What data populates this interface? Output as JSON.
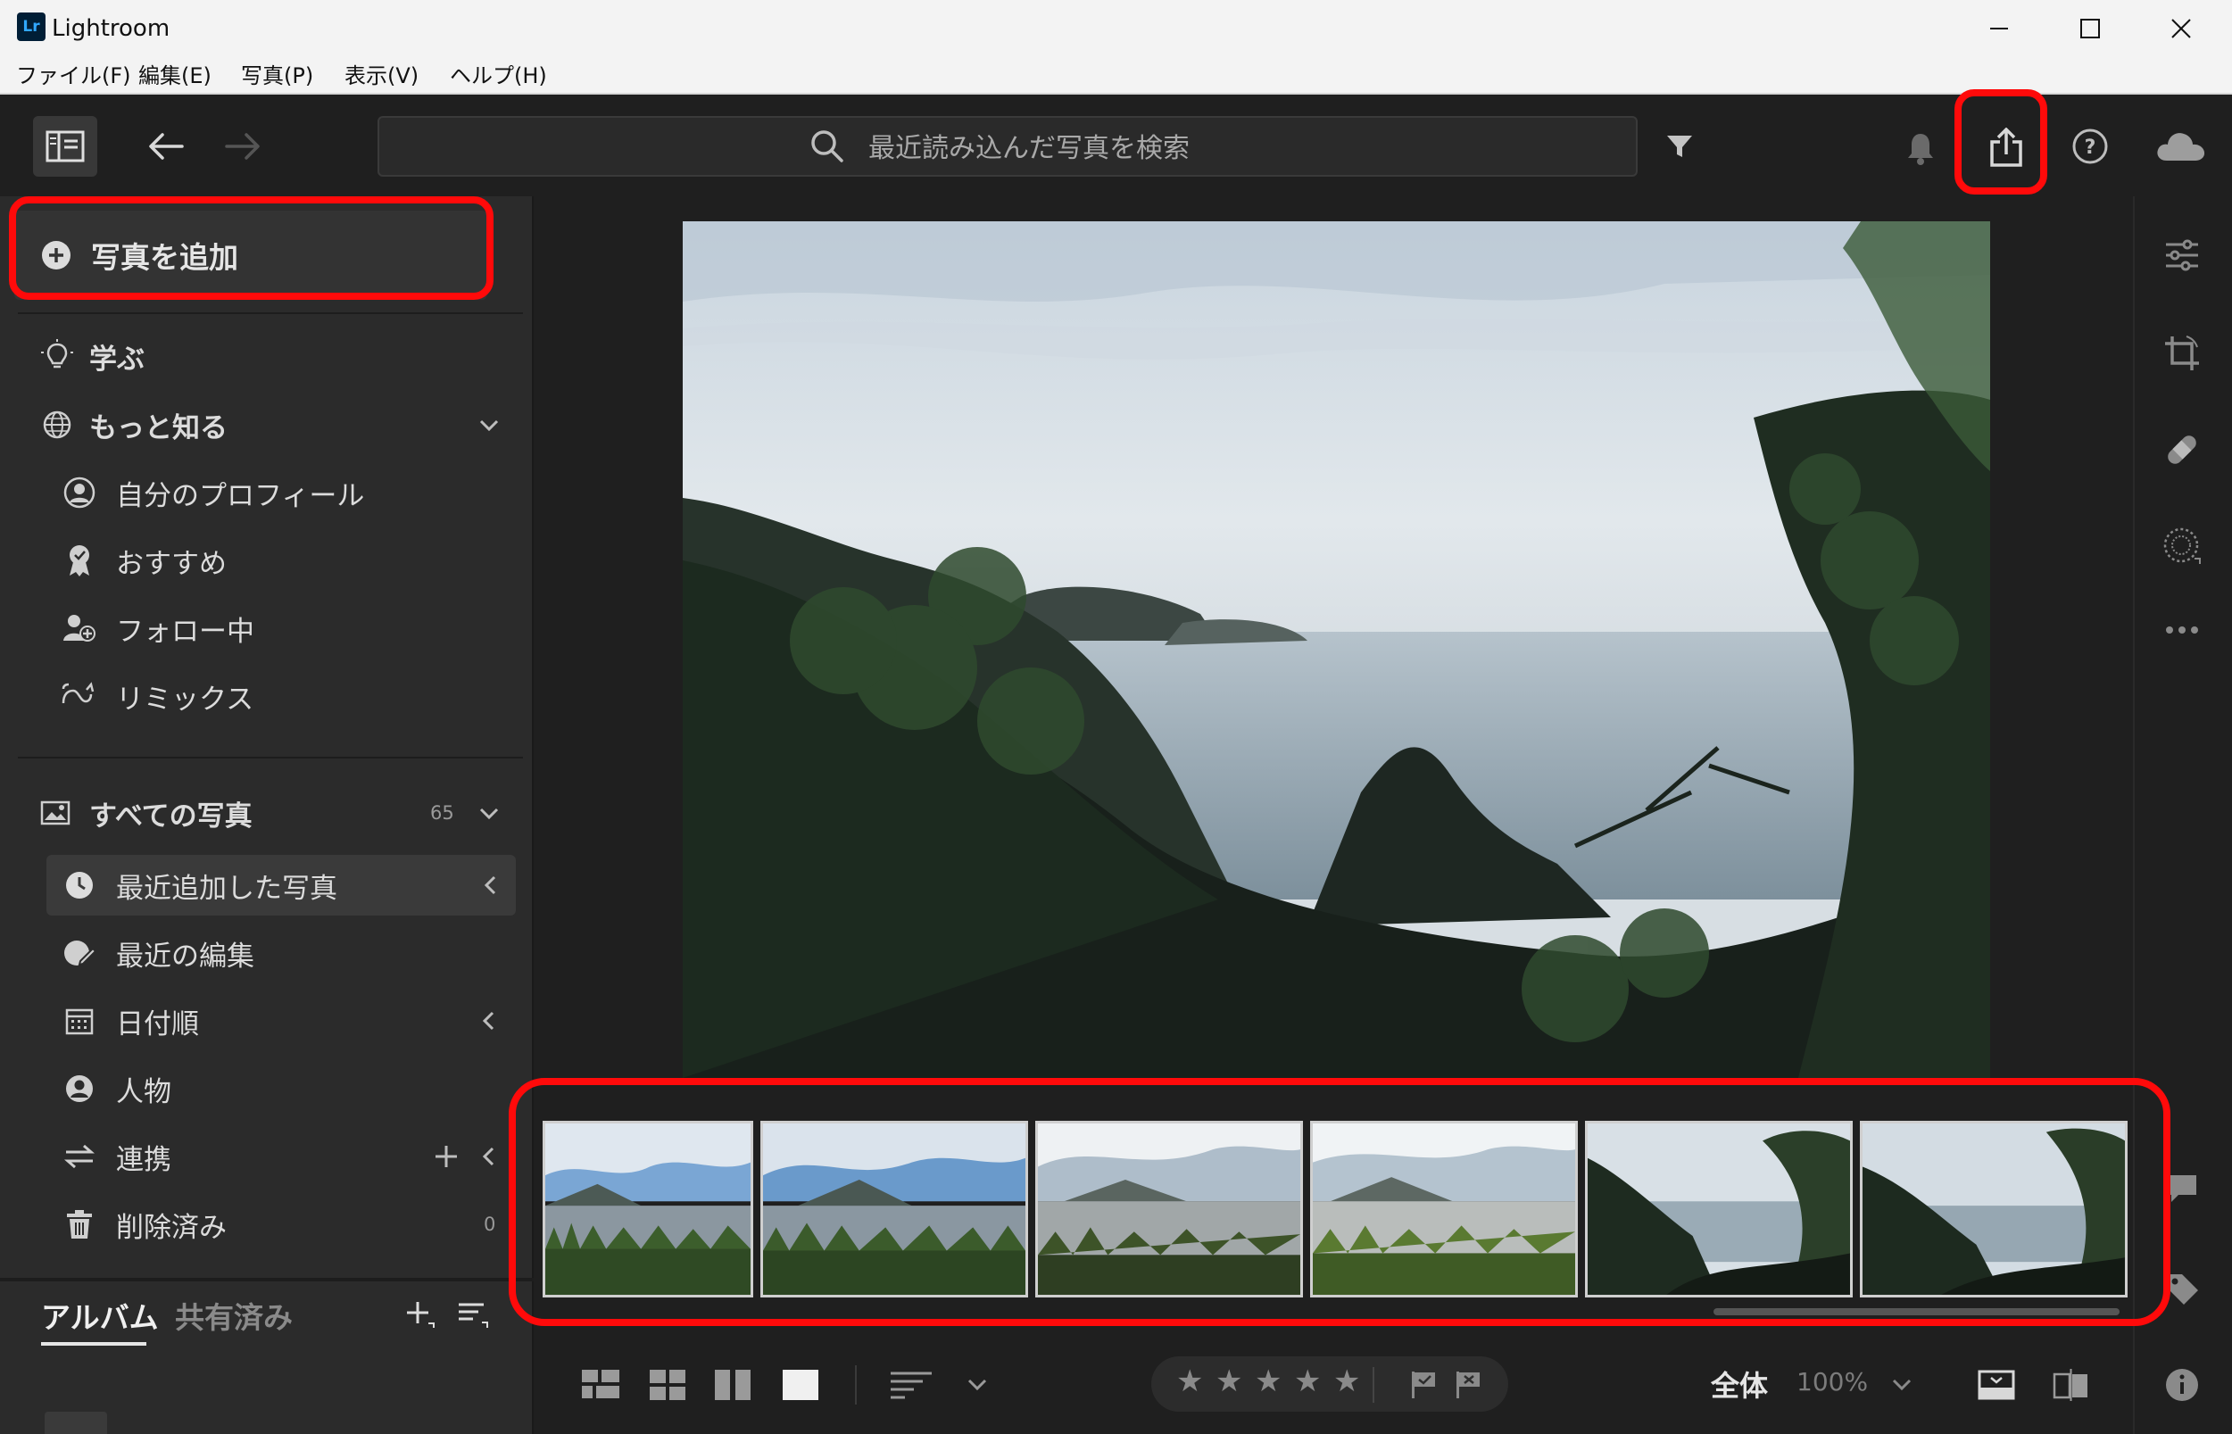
{
  "window": {
    "title": "Lightroom",
    "logo_text": "Lr"
  },
  "menu": [
    {
      "label": "ファイル(F)"
    },
    {
      "label": "編集(E)"
    },
    {
      "label": "写真(P)"
    },
    {
      "label": "表示(V)"
    },
    {
      "label": "ヘルプ(H)"
    }
  ],
  "toolbar": {
    "search_placeholder": "最近読み込んだ写真を検索"
  },
  "sidebar": {
    "add_photo": "写真を追加",
    "learn": "学ぶ",
    "discover": "もっと知る",
    "discover_items": [
      {
        "label": "自分のプロフィール",
        "icon": "profile-icon"
      },
      {
        "label": "おすすめ",
        "icon": "badge-icon"
      },
      {
        "label": "フォロー中",
        "icon": "follow-icon"
      },
      {
        "label": "リミックス",
        "icon": "remix-icon"
      }
    ],
    "all_photos": "すべての写真",
    "all_photos_count": "65",
    "library_items": [
      {
        "label": "最近追加した写真",
        "icon": "clock-icon",
        "selected": true
      },
      {
        "label": "最近の編集",
        "icon": "edit-icon"
      },
      {
        "label": "日付順",
        "icon": "calendar-icon"
      },
      {
        "label": "人物",
        "icon": "person-icon"
      },
      {
        "label": "連携",
        "icon": "sync-icon"
      },
      {
        "label": "削除済み",
        "icon": "trash-icon"
      }
    ],
    "deleted_count": "0",
    "tabs": {
      "albums": "アルバム",
      "shared": "共有済み"
    }
  },
  "bottom_bar": {
    "stars": [
      "★",
      "★",
      "★",
      "★",
      "★"
    ],
    "view_label": "全体",
    "zoom": "100%"
  },
  "accent": {
    "highlight": "#ff0a0a"
  }
}
